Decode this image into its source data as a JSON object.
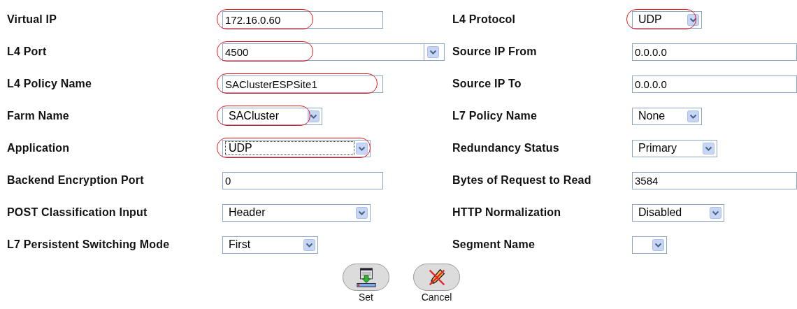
{
  "rows": [
    {
      "left": {
        "label": "Virtual IP",
        "kind": "text",
        "value": "172.16.0.60",
        "highlighted": true
      },
      "right": {
        "label": "L4 Protocol",
        "kind": "select",
        "value": "UDP",
        "highlighted": true
      }
    },
    {
      "left": {
        "label": "L4 Port",
        "kind": "combo",
        "value": "4500",
        "highlighted": true
      },
      "right": {
        "label": "Source IP From",
        "kind": "text",
        "value": "0.0.0.0",
        "highlighted": false
      }
    },
    {
      "left": {
        "label": "L4 Policy Name",
        "kind": "text",
        "value": "SAClusterESPSite1",
        "highlighted": true
      },
      "right": {
        "label": "Source IP To",
        "kind": "text",
        "value": "0.0.0.0",
        "highlighted": false
      }
    },
    {
      "left": {
        "label": "Farm Name",
        "kind": "select",
        "value": "SACluster",
        "highlighted": true
      },
      "right": {
        "label": "L7 Policy Name",
        "kind": "select",
        "value": "None",
        "highlighted": false
      }
    },
    {
      "left": {
        "label": "Application",
        "kind": "select",
        "value": "UDP",
        "highlighted": true,
        "focused": true
      },
      "right": {
        "label": "Redundancy Status",
        "kind": "select",
        "value": "Primary",
        "highlighted": false
      }
    },
    {
      "left": {
        "label": "Backend Encryption Port",
        "kind": "text",
        "value": "0",
        "highlighted": false
      },
      "right": {
        "label": "Bytes of Request to Read",
        "kind": "text",
        "value": "3584",
        "highlighted": false
      }
    },
    {
      "left": {
        "label": "POST Classification Input",
        "kind": "select",
        "value": "Header",
        "highlighted": false
      },
      "right": {
        "label": "HTTP Normalization",
        "kind": "select",
        "value": "Disabled",
        "highlighted": false
      }
    },
    {
      "left": {
        "label": "L7 Persistent Switching Mode",
        "kind": "select",
        "value": "First",
        "highlighted": false
      },
      "right": {
        "label": "Segment Name",
        "kind": "select",
        "highlighted": false
      }
    }
  ],
  "buttons": [
    {
      "label": "Set",
      "kind": "set"
    },
    {
      "label": "Cancel",
      "kind": "cancel"
    }
  ]
}
